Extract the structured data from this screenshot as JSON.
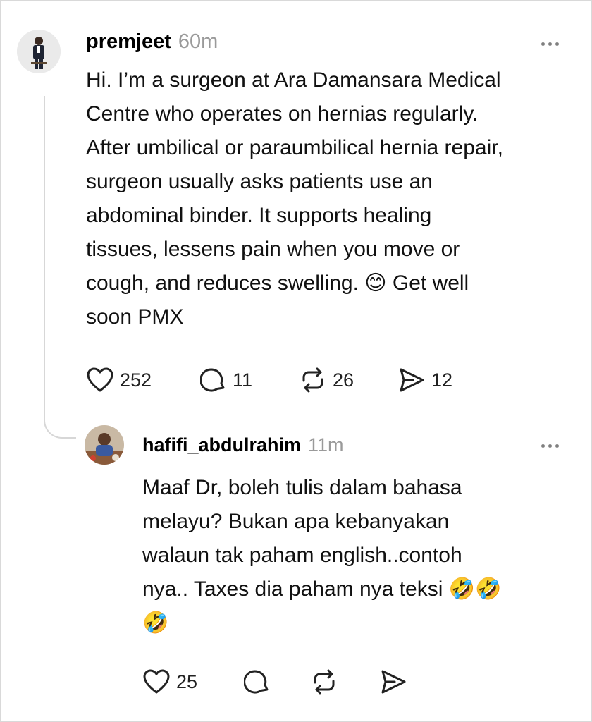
{
  "post": {
    "username": "premjeet",
    "time": "60m",
    "text": "Hi. I’m a surgeon at Ara Damansara Medical\nCentre who operates on hernias regularly.\nAfter umbilical or paraumbilical hernia repair,\nsurgeon usually asks patients use an\nabdominal binder.  It supports healing\ntissues, lessens pain when you move or\ncough, and reduces swelling. 😊 Get well\nsoon PMX",
    "likes": "252",
    "replies": "11",
    "reposts": "26",
    "shares": "12"
  },
  "reply": {
    "username": "hafifi_abdulrahim",
    "time": "11m",
    "text": "Maaf Dr, boleh tulis dalam bahasa\nmelayu? Bukan apa kebanyakan\nwalaun tak paham english..contoh\nnya.. Taxes dia paham nya teksi 🤣🤣\n🤣",
    "likes": "25"
  },
  "icons": {
    "like": "heart-icon",
    "reply": "comment-icon",
    "repost": "repost-icon",
    "share": "share-icon",
    "more": "more-options-icon"
  },
  "colors": {
    "icon": "#222222",
    "muted": "#9a9a9a",
    "thread_line": "#d7d7d7"
  }
}
